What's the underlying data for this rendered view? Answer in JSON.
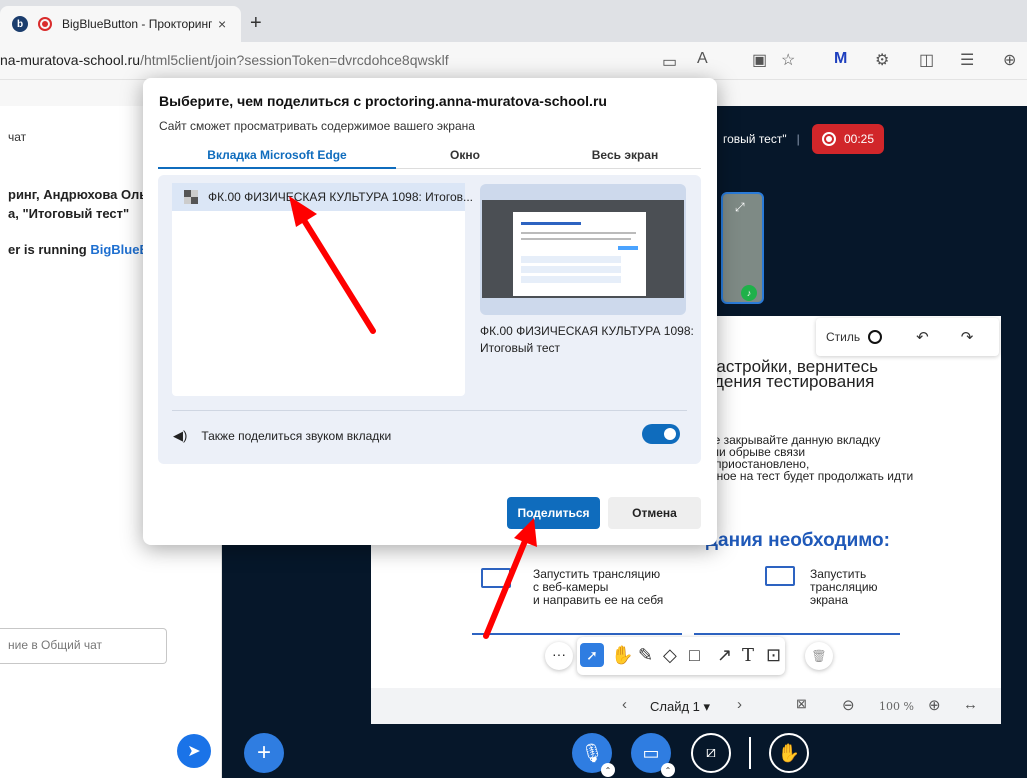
{
  "browser": {
    "tab_title": "BigBlueButton - Прокторинг",
    "tab_close": "×",
    "new_tab": "+",
    "url_main": "na-muratova-school.ru",
    "url_rest": "/html5client/join?sessionToken=dvrcdohce8qwsklf"
  },
  "chat": {
    "header": "чат",
    "message1_line1": "ринг, Андрюхова Оль",
    "message1_line2": "а, \"Итоговый тест\"",
    "message2_prefix": "er is running ",
    "message2_link": "BigBlueBu",
    "input_placeholder": "ние в Общий чат"
  },
  "session": {
    "title_fragment": "говый тест\"",
    "separator": "|",
    "recording_time": "00:25"
  },
  "whiteboard": {
    "style_label": "Стиль",
    "slide_text1": "настройки, вернитесь",
    "slide_text2": "дения тестирования",
    "slide_small1": "не закрывайте данную вкладку",
    "slide_small2": "ли обрыве связи",
    "slide_small3": "приостановлено,",
    "slide_small4": "нное на тест будет продолжать идти",
    "slide_heading": "дания необходимо:",
    "step1": [
      "Запустить трансляцию",
      "с веб-камеры",
      "и направить ее на себя"
    ],
    "step2": [
      "Запустить",
      "трансляцию",
      "экрана"
    ],
    "slide_label": "Слайд 1",
    "zoom": "100 %"
  },
  "modal": {
    "title": "Выберите, чем поделиться с proctoring.anna-muratova-school.ru",
    "subtitle": "Сайт сможет просматривать содержимое вашего экрана",
    "tabs": [
      "Вкладка Microsoft Edge",
      "Окно",
      "Весь экран"
    ],
    "list_item": "ФК.00 ФИЗИЧЕСКАЯ КУЛЬТУРА 1098: Итогов...",
    "preview_caption": "ФК.00 ФИЗИЧЕСКАЯ КУЛЬТУРА 1098: Итоговый тест",
    "audio_label": "Также поделиться звуком вкладки",
    "audio_enabled": true,
    "share_label": "Поделиться",
    "cancel_label": "Отмена"
  },
  "colors": {
    "accent": "#0f6cbd",
    "bbb_dark": "#06172a",
    "recording_red": "#d1262a",
    "annotation_arrow": "#ff0000"
  }
}
